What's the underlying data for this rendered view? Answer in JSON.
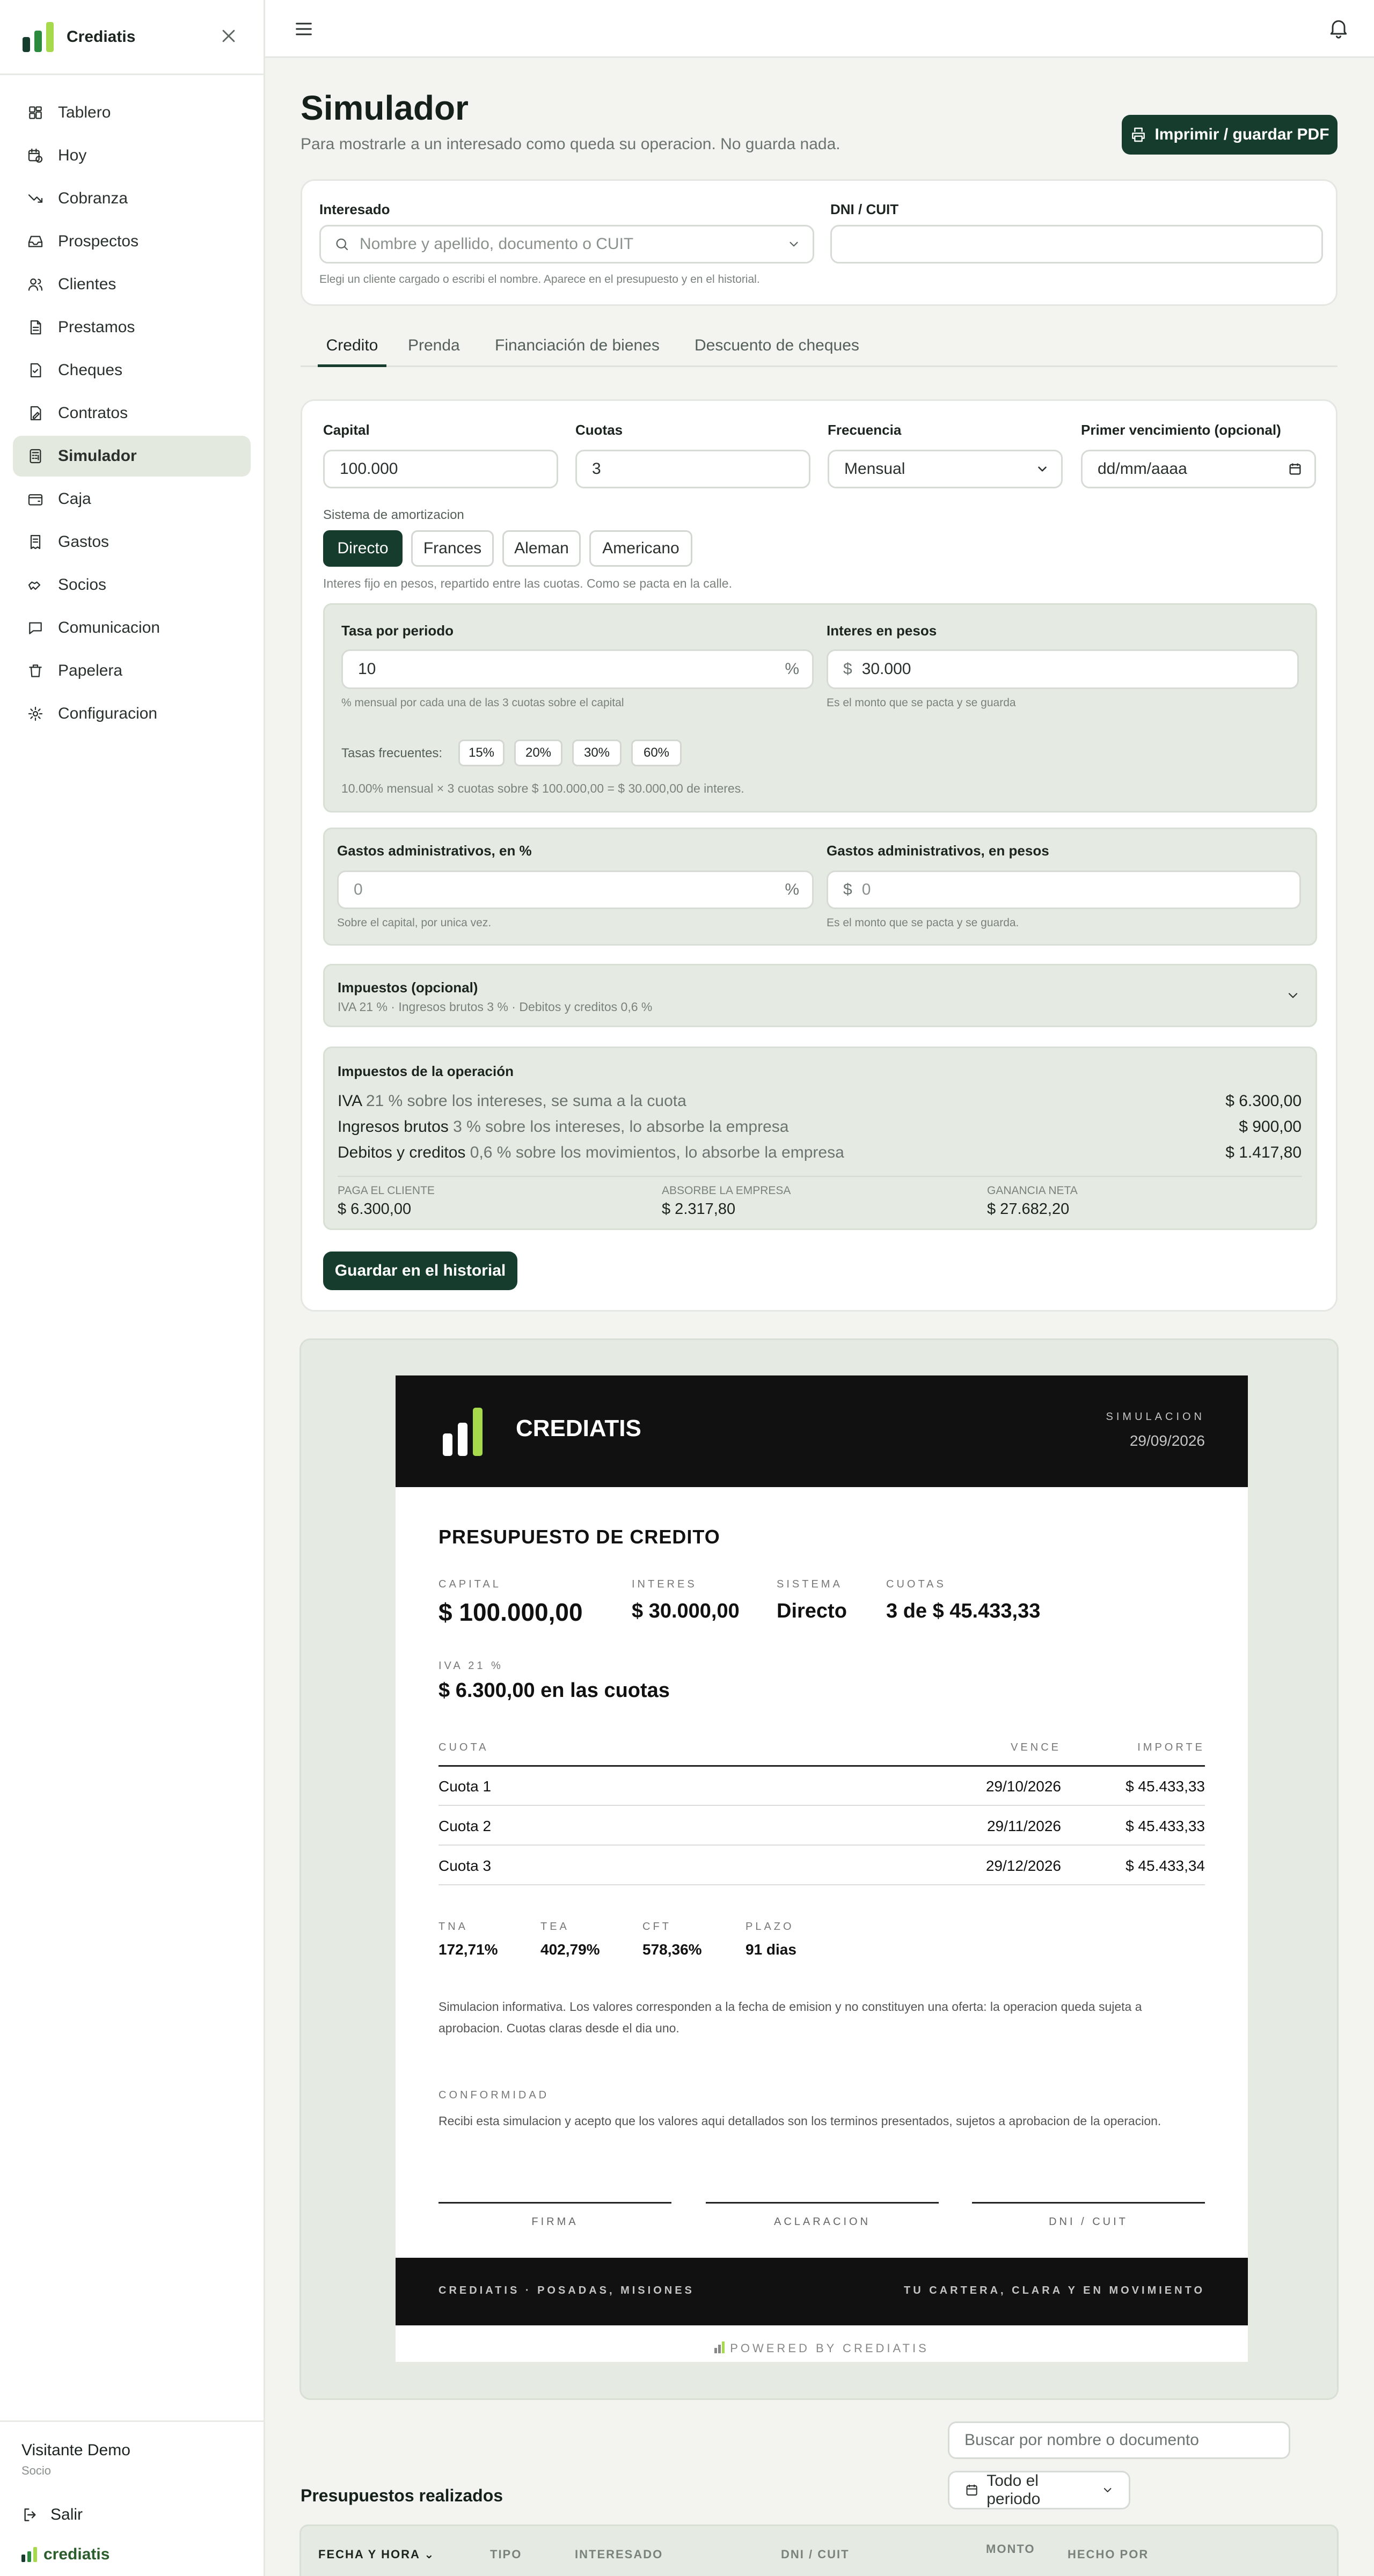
{
  "brand": {
    "name": "Crediatis",
    "colors": {
      "bar1": "#163c2d",
      "bar2": "#2b8a3e",
      "bar3": "#a6d94b"
    }
  },
  "sidebar": {
    "items": [
      {
        "label": "Tablero",
        "icon": "dashboard-icon"
      },
      {
        "label": "Hoy",
        "icon": "calendar-clock-icon"
      },
      {
        "label": "Cobranza",
        "icon": "trend-down-icon"
      },
      {
        "label": "Prospectos",
        "icon": "inbox-icon"
      },
      {
        "label": "Clientes",
        "icon": "users-icon"
      },
      {
        "label": "Prestamos",
        "icon": "document-icon"
      },
      {
        "label": "Cheques",
        "icon": "check-document-icon"
      },
      {
        "label": "Contratos",
        "icon": "contract-icon"
      },
      {
        "label": "Simulador",
        "icon": "calculator-icon"
      },
      {
        "label": "Caja",
        "icon": "wallet-icon"
      },
      {
        "label": "Gastos",
        "icon": "receipt-icon"
      },
      {
        "label": "Socios",
        "icon": "handshake-icon"
      },
      {
        "label": "Comunicacion",
        "icon": "message-icon"
      },
      {
        "label": "Papelera",
        "icon": "trash-icon"
      },
      {
        "label": "Configuracion",
        "icon": "gear-icon"
      }
    ],
    "user_name": "Visitante Demo",
    "user_role": "Socio",
    "logout_label": "Salir",
    "footer_brand": "crediatis"
  },
  "page": {
    "title": "Simulador",
    "subtitle": "Para mostrarle a un interesado como queda su operacion. No guarda nada.",
    "print_label": "Imprimir / guardar PDF"
  },
  "client": {
    "interesado_label": "Interesado",
    "interesado_placeholder": "Nombre y apellido, documento o CUIT",
    "interesado_hint": "Elegi un cliente cargado o escribi el nombre. Aparece en el presupuesto y en el historial.",
    "dni_label": "DNI / CUIT",
    "dni_value": ""
  },
  "tabs": [
    "Credito",
    "Prenda",
    "Financiación de bienes",
    "Descuento de cheques"
  ],
  "form": {
    "capital_label": "Capital",
    "capital_value": "100.000",
    "cuotas_label": "Cuotas",
    "cuotas_value": "3",
    "frecuencia_label": "Frecuencia",
    "frecuencia_value": "Mensual",
    "vencimiento_label": "Primer vencimiento (opcional)",
    "vencimiento_placeholder": "dd/mm/aaaa",
    "sistema_label": "Sistema de amortizacion",
    "sistemas": [
      "Directo",
      "Frances",
      "Aleman",
      "Americano"
    ],
    "sistema_hint": "Interes fijo en pesos, repartido entre las cuotas. Como se pacta en la calle.",
    "tasa_label": "Tasa por periodo",
    "tasa_value": "10",
    "tasa_unit": "%",
    "tasa_hint": "% mensual por cada una de las 3 cuotas sobre el capital",
    "interes_label": "Interes en pesos",
    "interes_prefix": "$",
    "interes_value": "30.000",
    "interes_hint": "Es el monto que se pacta y se guarda",
    "tasas_frecuentes_label": "Tasas frecuentes:",
    "tasas_frecuentes": [
      "15%",
      "20%",
      "30%",
      "60%"
    ],
    "tasa_summary": "10.00% mensual × 3 cuotas sobre $ 100.000,00 = $ 30.000,00 de interes.",
    "gastos_pct_label": "Gastos administrativos, en %",
    "gastos_pct_value": "0",
    "gastos_pct_unit": "%",
    "gastos_pct_hint": "Sobre el capital, por unica vez.",
    "gastos_pesos_label": "Gastos administrativos, en pesos",
    "gastos_pesos_prefix": "$",
    "gastos_pesos_value": "0",
    "gastos_pesos_hint": "Es el monto que se pacta y se guarda.",
    "impuestos_title": "Impuestos (opcional)",
    "impuestos_sub": "IVA 21 % · Ingresos brutos 3 % · Debitos y creditos 0,6 %",
    "impuestos_op_title": "Impuestos de la operación",
    "tax_rows": [
      {
        "name": "IVA",
        "desc": " 21 % sobre los intereses, se suma a la cuota",
        "value": "$ 6.300,00"
      },
      {
        "name": "Ingresos brutos",
        "desc": " 3 % sobre los intereses, lo absorbe la empresa",
        "value": "$ 900,00"
      },
      {
        "name": "Debitos y creditos",
        "desc": " 0,6 % sobre los movimientos, lo absorbe la empresa",
        "value": "$ 1.417,80"
      }
    ],
    "summary": [
      {
        "label": "PAGA EL CLIENTE",
        "value": "$ 6.300,00"
      },
      {
        "label": "ABSORBE LA EMPRESA",
        "value": "$ 2.317,80"
      },
      {
        "label": "GANANCIA NETA",
        "value": "$ 27.682,20"
      }
    ],
    "save_label": "Guardar en el historial"
  },
  "doc": {
    "brand": "CREDIATIS",
    "sim_label": "SIMULACION",
    "date": "29/09/2026",
    "title": "PRESUPUESTO DE CREDITO",
    "kv": [
      {
        "label": "CAPITAL",
        "value": "$ 100.000,00"
      },
      {
        "label": "INTERES",
        "value": "$ 30.000,00"
      },
      {
        "label": "SISTEMA",
        "value": "Directo"
      },
      {
        "label": "CUOTAS",
        "value": "3 de $ 45.433,33"
      }
    ],
    "iva_label": "IVA 21 %",
    "iva_value": "$ 6.300,00 en las cuotas",
    "table_headers": [
      "CUOTA",
      "VENCE",
      "IMPORTE"
    ],
    "rows": [
      {
        "cuota": "Cuota 1",
        "vence": "29/10/2026",
        "importe": "$ 45.433,33"
      },
      {
        "cuota": "Cuota 2",
        "vence": "29/11/2026",
        "importe": "$ 45.433,33"
      },
      {
        "cuota": "Cuota 3",
        "vence": "29/12/2026",
        "importe": "$ 45.433,34"
      }
    ],
    "rates": [
      {
        "label": "TNA",
        "value": "172,71%"
      },
      {
        "label": "TEA",
        "value": "402,79%"
      },
      {
        "label": "CFT",
        "value": "578,36%"
      },
      {
        "label": "PLAZO",
        "value": "91 dias"
      }
    ],
    "disclaimer": "Simulacion informativa. Los valores corresponden a la fecha de emision y no constituyen una oferta: la operacion queda sujeta a aprobacion. Cuotas claras desde el dia uno.",
    "conformidad_label": "CONFORMIDAD",
    "conformidad_text": "Recibi esta simulacion y acepto que los valores aqui detallados son los terminos presentados, sujetos a aprobacion de la operacion.",
    "signatures": [
      "FIRMA",
      "ACLARACION",
      "DNI / CUIT"
    ],
    "footer_left": "CREDIATIS · POSADAS, MISIONES",
    "footer_right": "TU CARTERA, CLARA Y EN MOVIMIENTO",
    "powered": "POWERED BY CREDIATIS"
  },
  "history": {
    "search_placeholder": "Buscar por nombre o documento",
    "period_label": "Todo el periodo",
    "title": "Presupuestos realizados",
    "columns": [
      "FECHA Y HORA",
      "TIPO",
      "INTERESADO",
      "DNI / CUIT",
      "MONTO",
      "HECHO POR"
    ]
  }
}
